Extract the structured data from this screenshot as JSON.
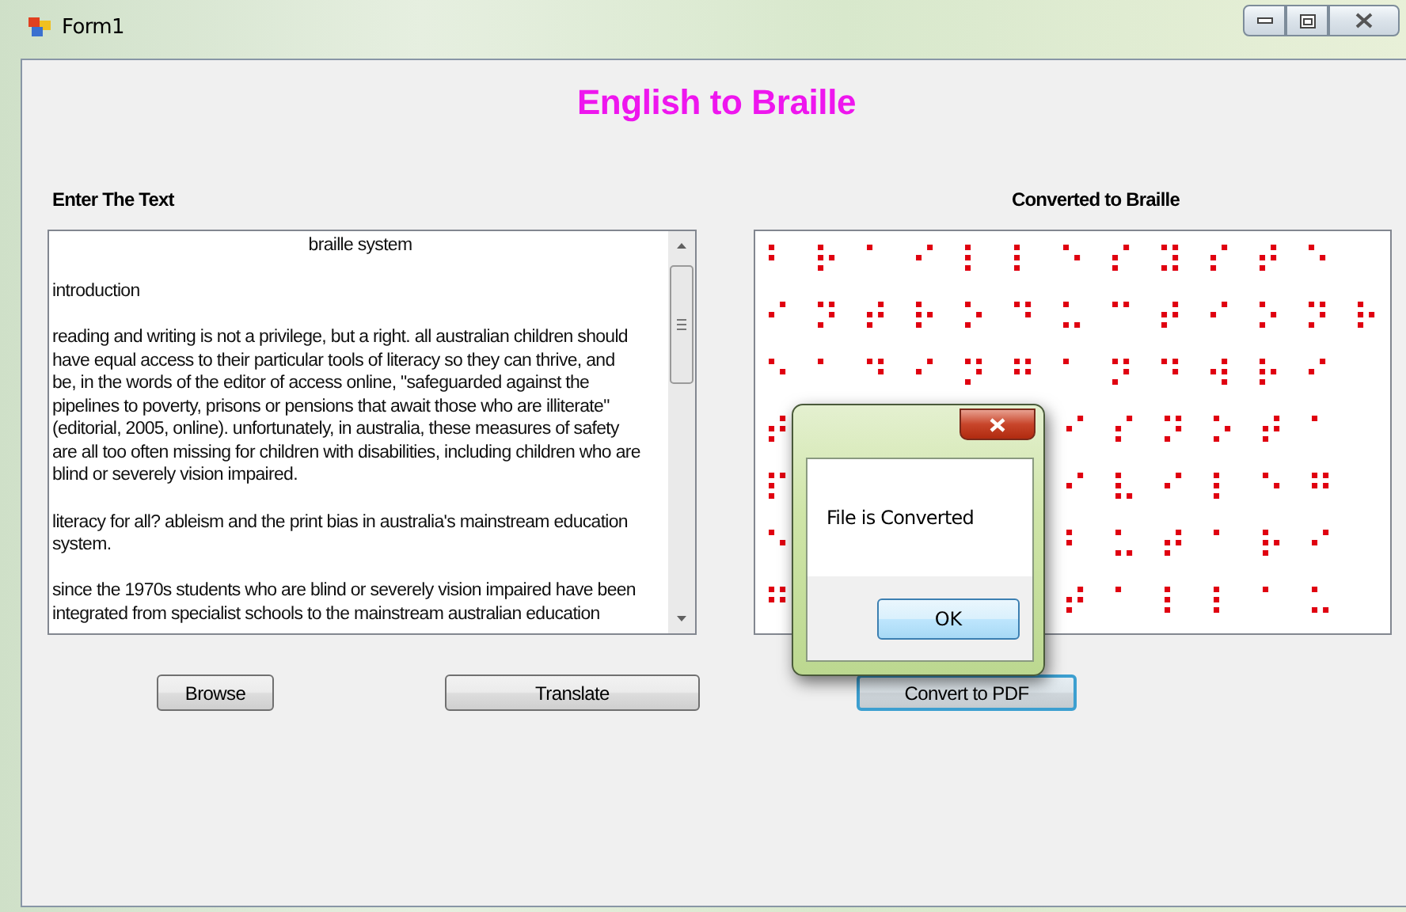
{
  "window": {
    "title": "Form1"
  },
  "heading": "English to Braille",
  "input": {
    "label": "Enter The Text",
    "paragraphs": [
      {
        "kind": "title",
        "lines": [
          "braille system"
        ]
      },
      {
        "kind": "text",
        "lines": [
          "introduction"
        ]
      },
      {
        "kind": "text",
        "lines": [
          "reading and writing is not a privilege, but a right. all australian children should",
          "have equal access to their particular tools of literacy so they can thrive, and",
          "be, in the words of the editor of access online, \"safeguarded against the",
          "pipelines to poverty, prisons or pensions that await those who are illiterate\"",
          "(editorial, 2005, online). unfortunately, in australia, these measures of safety",
          "are all too often missing for children with disabilities, including children who are",
          "blind or severely vision impaired."
        ]
      },
      {
        "kind": "text",
        "lines": [
          "literacy for all? ableism and the print bias in australia's mainstream education",
          "system."
        ]
      },
      {
        "kind": "text",
        "lines": [
          "since the 1970s students who are blind or severely vision impaired have been",
          "integrated from specialist schools to the mainstream australian education"
        ]
      }
    ]
  },
  "output": {
    "label": "Converted to Braille",
    "rows": [
      [
        "⠃⠗⠁⠊⠇⠇⠑⠎⠽⠎⠞⠑"
      ],
      [
        "⠊⠝⠞⠗⠕⠙⠥⠉⠞⠊⠕⠝⠗"
      ],
      [
        "⠑⠁⠙⠊⠝⠛⠁⠝⠙⠺⠗⠊"
      ],
      [
        "⠞",
        "⠊⠎⠝⠕⠞⠁"
      ],
      [
        "⠏",
        "⠊⠧⠊⠇⠑⠛"
      ],
      [
        "⠑",
        "⠃⠥⠞⠁⠗⠊"
      ],
      [
        "⠛",
        "⠞⠁⠇⠇⠁⠥"
      ]
    ]
  },
  "buttons": [
    {
      "label": "Browse",
      "focused": false
    },
    {
      "label": "Translate",
      "focused": false
    },
    {
      "label": "Convert to PDF",
      "focused": true
    }
  ],
  "dialog": {
    "message": "File is Converted",
    "button": "OK"
  }
}
